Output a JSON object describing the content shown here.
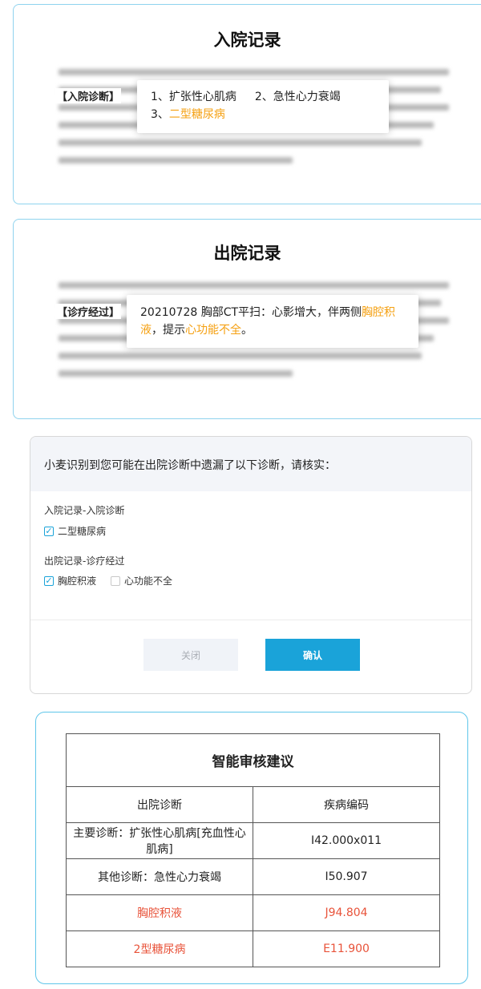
{
  "admission": {
    "title": "入院记录",
    "section_label": "【入院诊断】",
    "diagnoses": [
      {
        "num": "1、",
        "name": "扩张性心肌病"
      },
      {
        "num": "2、",
        "name": "急性心力衰竭"
      },
      {
        "num": "3、",
        "name": "二型糖尿病",
        "highlight": true
      }
    ]
  },
  "discharge": {
    "title": "出院记录",
    "section_label": "【诊疗经过】",
    "text_before": "20210728 胸部CT平扫：心影增大，伴两侧",
    "hl1": "胸腔积液",
    "text_mid": "，提示",
    "hl2": "心功能不全",
    "text_after": "。"
  },
  "dialog": {
    "message": "小麦识别到您可能在出院诊断中遗漏了以下诊断，请核实：",
    "groups": [
      {
        "title": "入院记录-入院诊断",
        "items": [
          {
            "label": "二型糖尿病",
            "checked": true
          }
        ]
      },
      {
        "title": "出院记录-诊疗经过",
        "items": [
          {
            "label": "胸腔积液",
            "checked": true
          },
          {
            "label": "心功能不全",
            "checked": false
          }
        ]
      }
    ],
    "close_label": "关闭",
    "confirm_label": "确认"
  },
  "suggestion": {
    "title": "智能审核建议",
    "headers": [
      "出院诊断",
      "疾病编码"
    ],
    "rows": [
      {
        "diagnosis": "主要诊断：扩张性心肌病[充血性心肌病]",
        "code": "I42.000x011",
        "missing": false
      },
      {
        "diagnosis": "其他诊断：急性心力衰竭",
        "code": "I50.907",
        "missing": false
      },
      {
        "diagnosis": "胸腔积液",
        "code": "J94.804",
        "missing": true
      },
      {
        "diagnosis": "2型糖尿病",
        "code": "E11.900",
        "missing": true
      }
    ]
  },
  "colors": {
    "accent": "#1aa3d9",
    "highlight_orange": "#f5a011",
    "missing_red": "#e8533a",
    "panel_border": "#8fd3ee"
  }
}
